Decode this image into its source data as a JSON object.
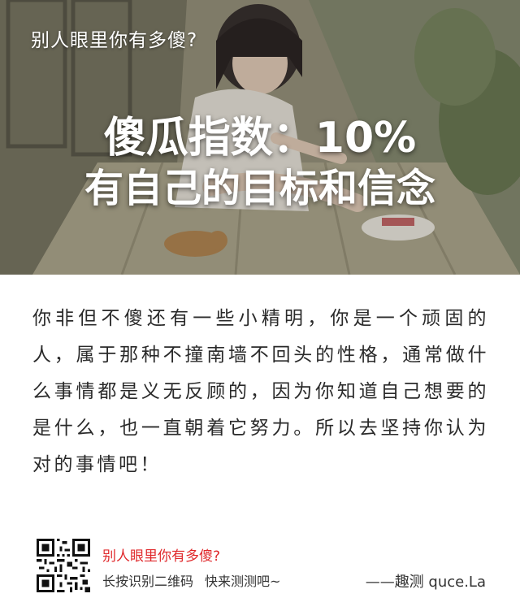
{
  "hero": {
    "caption": "别人眼里你有多傻?",
    "headline_line1": "傻瓜指数：10%",
    "headline_line2": "有自己的目标和信念"
  },
  "result": {
    "text": "你非但不傻还有一些小精明，你是一个顽固的人，属于那种不撞南墙不回头的性格，通常做什么事情都是义无反顾的，因为你知道自己想要的是什么，也一直朝着它努力。所以去坚持你认为对的事情吧！"
  },
  "footer": {
    "title": "别人眼里你有多傻?",
    "sub_left": "长按识别二维码",
    "sub_right": "快来测测吧~",
    "signature": "——趣测 quce.La"
  },
  "colors": {
    "accent_red": "#e0292c",
    "body_text": "#2a2a2a"
  }
}
